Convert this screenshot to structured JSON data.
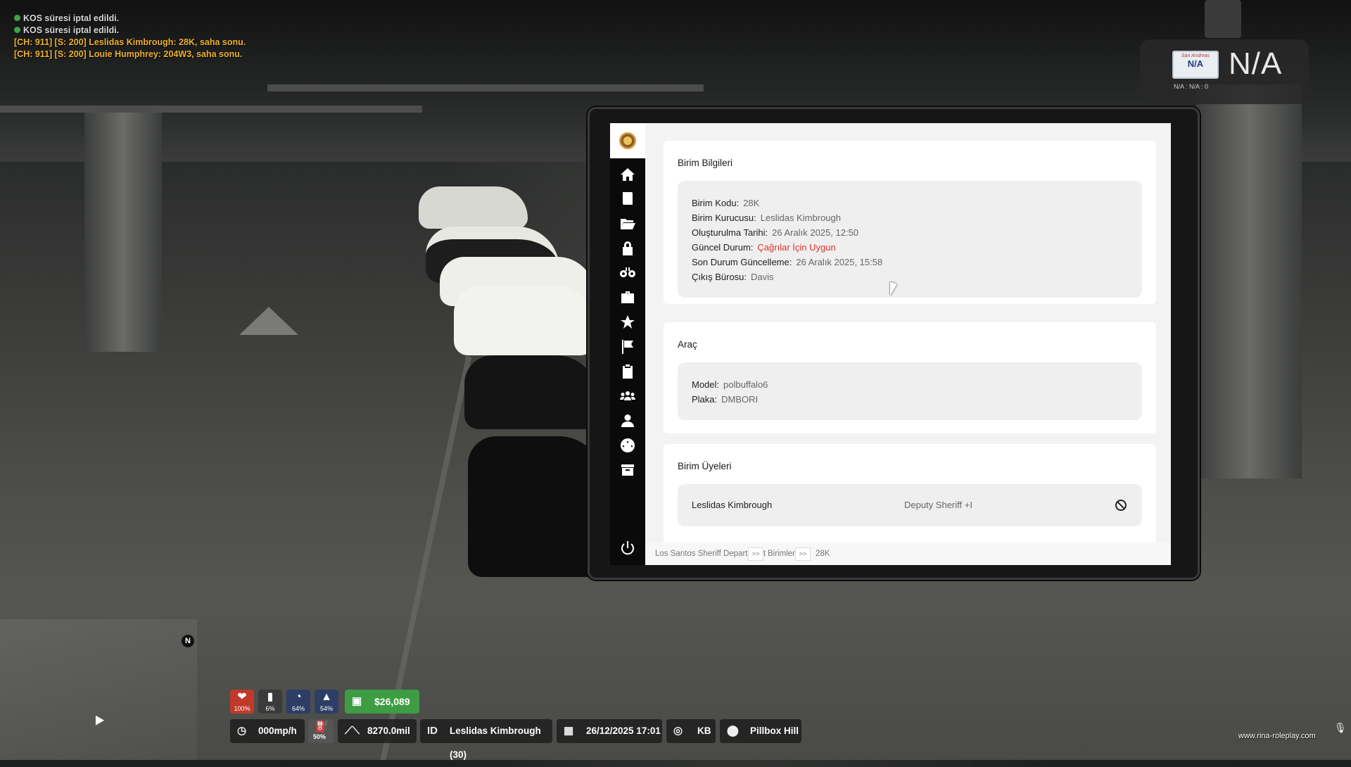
{
  "chat": {
    "lines": [
      {
        "type": "system",
        "text": "KOS süresi iptal edildi."
      },
      {
        "type": "system",
        "text": "KOS süresi iptal edildi."
      },
      {
        "type": "radio",
        "text": "[CH: 911] [S: 200] Leslidas Kimbrough: 28K, saha sonu."
      },
      {
        "type": "radio",
        "text": "[CH: 911] [S: 200] Louie Humphrey: 204W3, saha sonu."
      }
    ]
  },
  "plate": {
    "state": "San Andreas",
    "number": "N/A",
    "big_text": "N/A",
    "sub_text": "N/A : N/A : 0"
  },
  "tablet": {
    "sidebar": {
      "items": [
        {
          "name": "home",
          "icon": "home-icon"
        },
        {
          "name": "reports",
          "icon": "document-icon"
        },
        {
          "name": "files",
          "icon": "folder-open-icon"
        },
        {
          "name": "locks",
          "icon": "lock-icon"
        },
        {
          "name": "search",
          "icon": "binoculars-icon"
        },
        {
          "name": "cases",
          "icon": "briefcase-icon"
        },
        {
          "name": "favorites",
          "icon": "star-icon"
        },
        {
          "name": "flags",
          "icon": "flag-icon"
        },
        {
          "name": "evidence",
          "icon": "clipboard-icon"
        },
        {
          "name": "groups",
          "icon": "users-icon"
        },
        {
          "name": "profile",
          "icon": "user-icon"
        },
        {
          "name": "dashboard",
          "icon": "gauge-icon"
        },
        {
          "name": "archive",
          "icon": "archive-icon"
        }
      ],
      "power": "power-icon"
    },
    "unit_info": {
      "title": "Birim Bilgileri",
      "code_label": "Birim Kodu:",
      "code_value": "28K",
      "founder_label": "Birim Kurucusu:",
      "founder_value": "Leslidas Kimbrough",
      "created_label": "Oluşturulma Tarihi:",
      "created_value": "26 Aralık 2025, 12:50",
      "status_label": "Güncel Durum:",
      "status_value": "Çağrılar İçin Uygun",
      "status_color": "#e0332b",
      "updated_label": "Son Durum Güncelleme:",
      "updated_value": "26 Aralık 2025, 15:58",
      "office_label": "Çıkış Bürosu:",
      "office_value": "Davis"
    },
    "vehicle": {
      "title": "Araç",
      "model_label": "Model:",
      "model_value": "polbuffalo6",
      "plate_label": "Plaka:",
      "plate_value": "DMBORI"
    },
    "members": {
      "title": "Birim Üyeleri",
      "list": [
        {
          "name": "Leslidas Kimbrough",
          "rank": "Deputy Sheriff +I"
        }
      ]
    },
    "breadcrumb": {
      "items": [
        "Los Santos Sheriff Department",
        "Birimler",
        "28K"
      ],
      "separator": ">>"
    }
  },
  "hud": {
    "stats": [
      {
        "name": "health",
        "value": "100%",
        "color": "#c0392b"
      },
      {
        "name": "armor",
        "value": "6%",
        "color": "#444444"
      },
      {
        "name": "hunger",
        "value": "64%",
        "color": "#2c3e66"
      },
      {
        "name": "thirst",
        "value": "54%",
        "color": "#2c3e66"
      }
    ],
    "money": "$26,089",
    "speed": "000mp/h",
    "fuel": "50%",
    "mileage": "8270.0mil",
    "id_label": "ID",
    "player": "Leslidas Kimbrough (30)",
    "datetime": "26/12/2025 17:01",
    "direction": "KB",
    "location": "Pillbox Hill",
    "minimap_north": "N",
    "website": "www.rina-roleplay.com"
  }
}
